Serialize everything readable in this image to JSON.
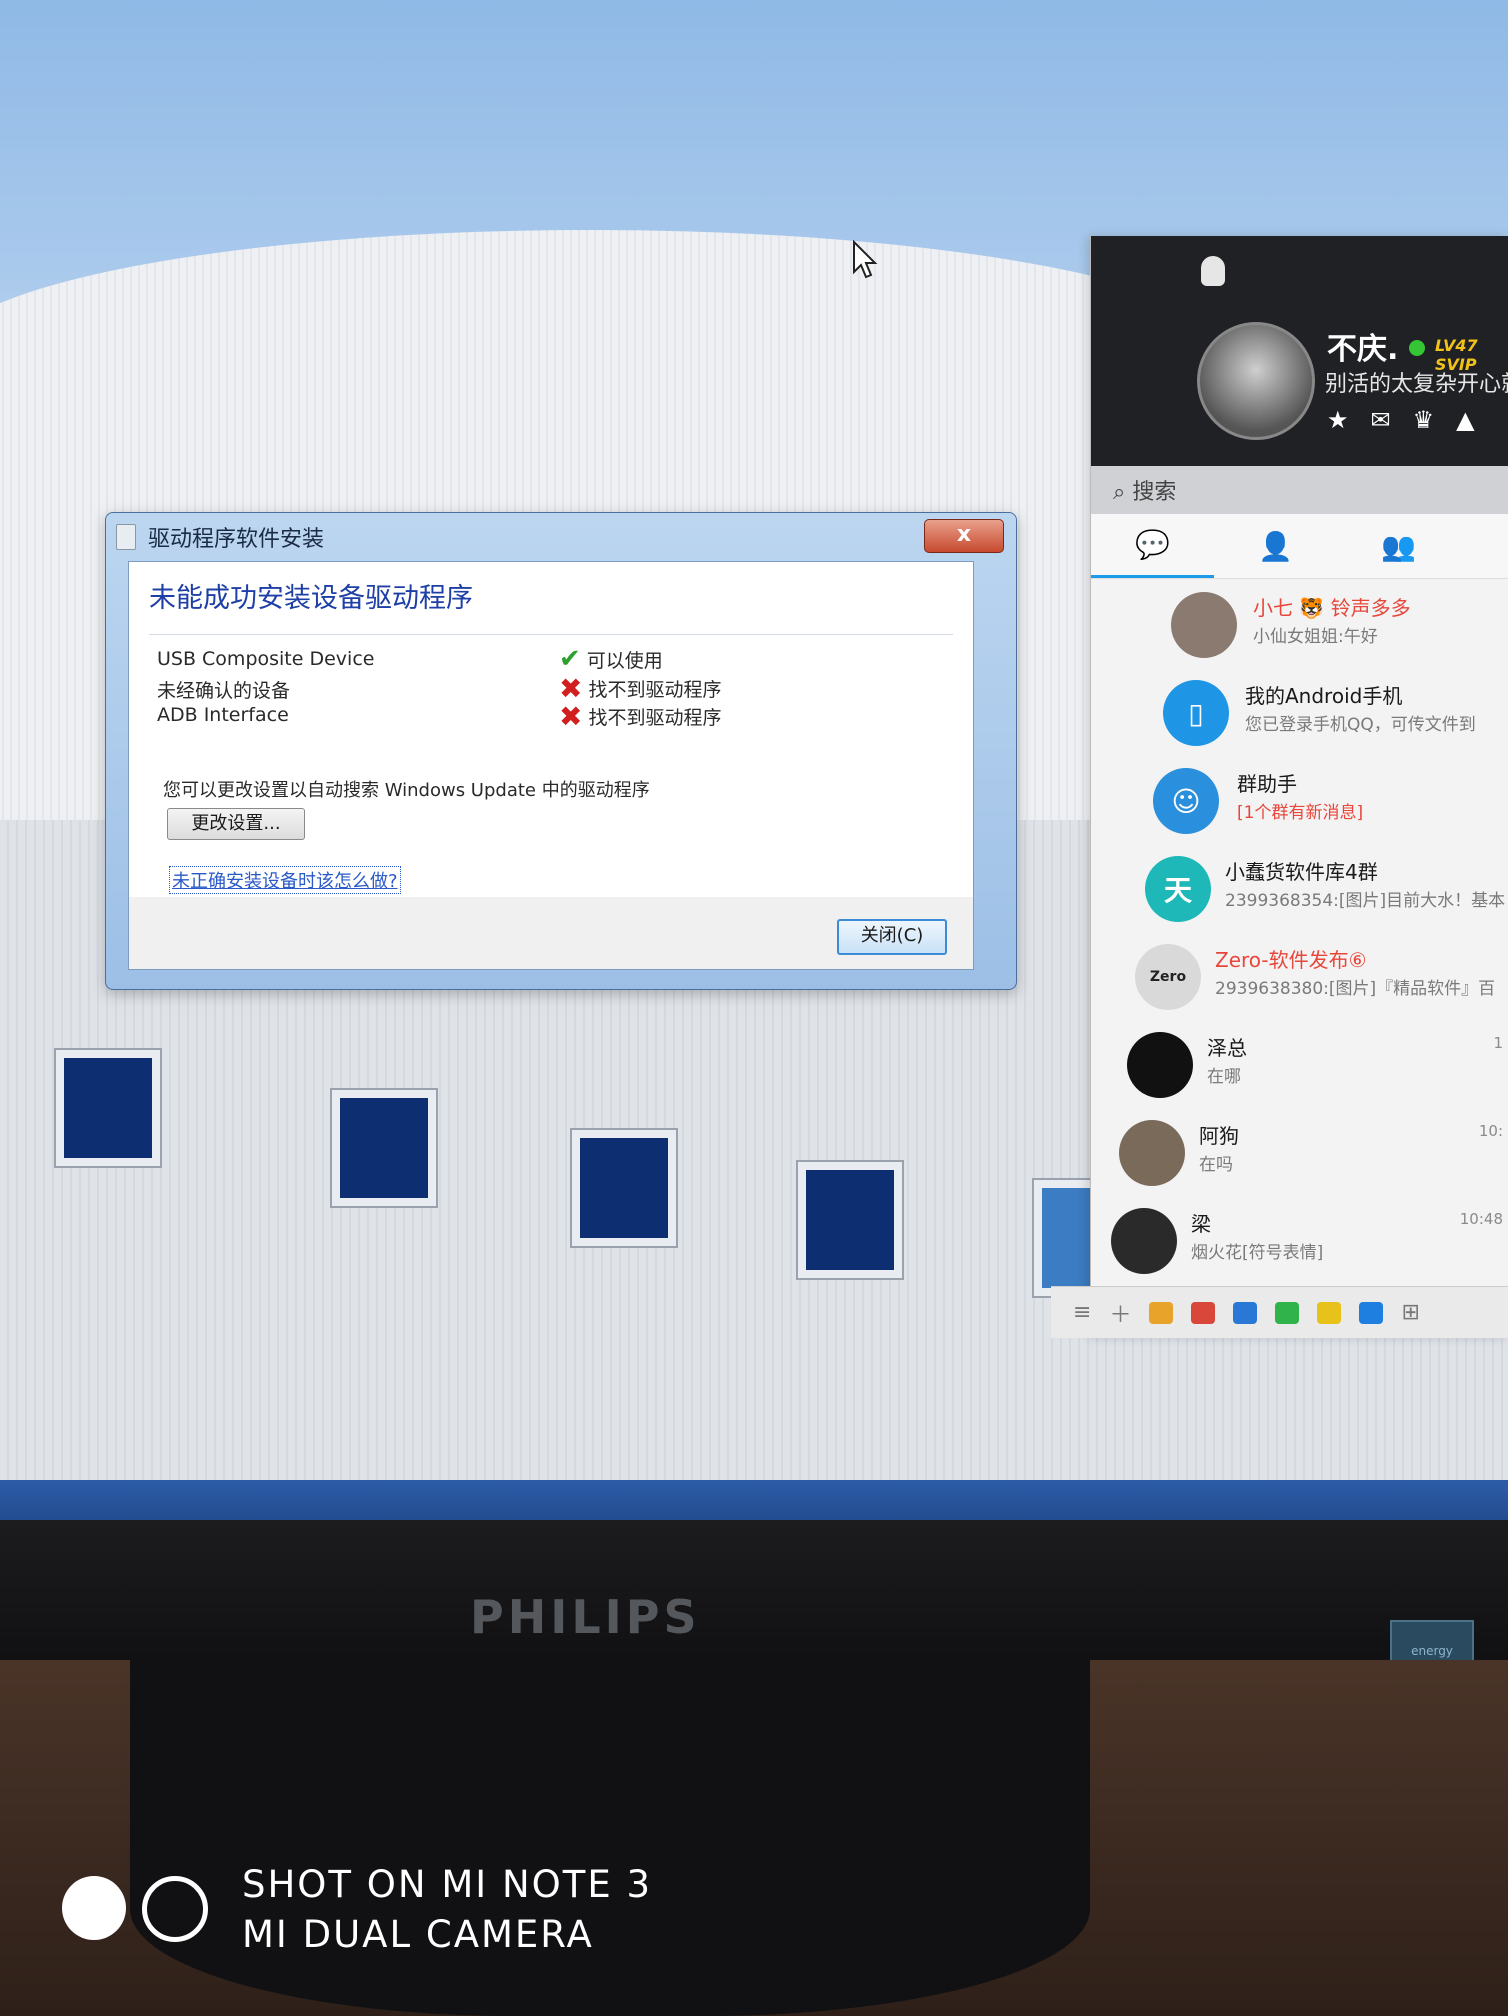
{
  "dialog": {
    "title": "驱动程序软件安装",
    "heading": "未能成功安装设备驱动程序",
    "devices": [
      {
        "name": "USB Composite Device",
        "status": "可以使用",
        "status_icon": "check-icon"
      },
      {
        "name": "未经确认的设备",
        "status": "找不到驱动程序",
        "status_icon": "error-x-icon"
      },
      {
        "name": "ADB Interface",
        "status": "找不到驱动程序",
        "status_icon": "error-x-icon"
      }
    ],
    "hint": "您可以更改设置以自动搜索 Windows Update 中的驱动程序",
    "change_settings_label": "更改设置...",
    "help_link": "未正确安装设备时该怎么做?",
    "close_label": "关闭(C)",
    "close_x": "x"
  },
  "qq": {
    "nickname": "不庆.",
    "level_badge": "LV47 SVIP",
    "signature": "别活的太复杂开心就",
    "search_label": "搜索",
    "tabs": [
      "messages-tab",
      "contacts-tab",
      "groups-tab"
    ],
    "conversations": [
      {
        "name": "小七 🐯 铃声多多",
        "message": "小仙女姐姐:午好",
        "time": "",
        "name_color": "red",
        "avatar_color": "#8a7a70"
      },
      {
        "name": "我的Android手机",
        "message": "您已登录手机QQ，可传文件到",
        "time": "",
        "name_color": "black",
        "avatar_color": "#1f95e6"
      },
      {
        "name": "群助手",
        "message": "[1个群有新消息]",
        "time": "",
        "name_color": "black",
        "message_color": "red",
        "avatar_color": "#2a8fdc"
      },
      {
        "name": "小蠢货软件库4群",
        "message": "2399368354:[图片]目前大水！基本",
        "time": "",
        "name_color": "black",
        "avatar_color": "#1fb8b8"
      },
      {
        "name": "Zero-软件发布⑥",
        "message": "2939638380:[图片]『精品软件』百",
        "time": "",
        "name_color": "red",
        "avatar_color": "#d9d9d9"
      },
      {
        "name": "泽总",
        "message": "在哪",
        "time": "1",
        "name_color": "black",
        "avatar_color": "#111111"
      },
      {
        "name": "阿狗",
        "message": "在吗",
        "time": "10:",
        "name_color": "black",
        "avatar_color": "#7a6a5a"
      },
      {
        "name": "梁",
        "message": "烟火花[符号表情]",
        "time": "10:48",
        "name_color": "black",
        "avatar_color": "#2a2a2a"
      }
    ]
  },
  "monitor": {
    "brand": "PHILIPS",
    "energy_label": "energy"
  },
  "camera_watermark": {
    "line1": "SHOT ON MI NOTE 3",
    "line2": "MI DUAL CAMERA"
  }
}
